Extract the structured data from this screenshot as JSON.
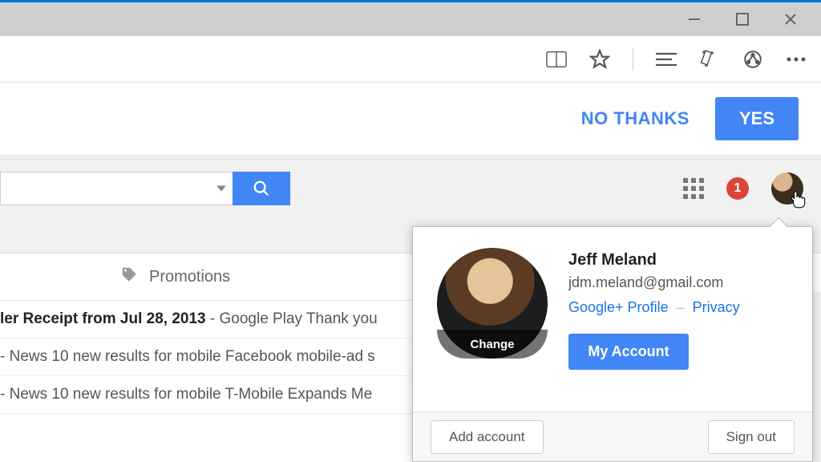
{
  "window": {
    "minimize": "–",
    "maximize": "☐",
    "close": "✕"
  },
  "notification": {
    "no_label": "NO THANKS",
    "yes_label": "YES"
  },
  "header": {
    "notif_count": "1"
  },
  "tabs": {
    "promotions_label": "Promotions"
  },
  "emails": [
    {
      "subject_fragment": "ler Receipt from Jul 28, 2013",
      "snippet": " - Google Play Thank you"
    },
    {
      "subject_fragment": "",
      "snippet": " - News 10 new results for mobile Facebook mobile-ad s"
    },
    {
      "subject_fragment": "",
      "snippet": " - News 10 new results for mobile T-Mobile Expands Me"
    }
  ],
  "account": {
    "name": "Jeff Meland",
    "email": "jdm.meland@gmail.com",
    "profile_link": "Google+ Profile",
    "privacy_link": "Privacy",
    "link_separator": "–",
    "my_account_label": "My Account",
    "change_label": "Change",
    "add_account_label": "Add account",
    "sign_out_label": "Sign out"
  }
}
